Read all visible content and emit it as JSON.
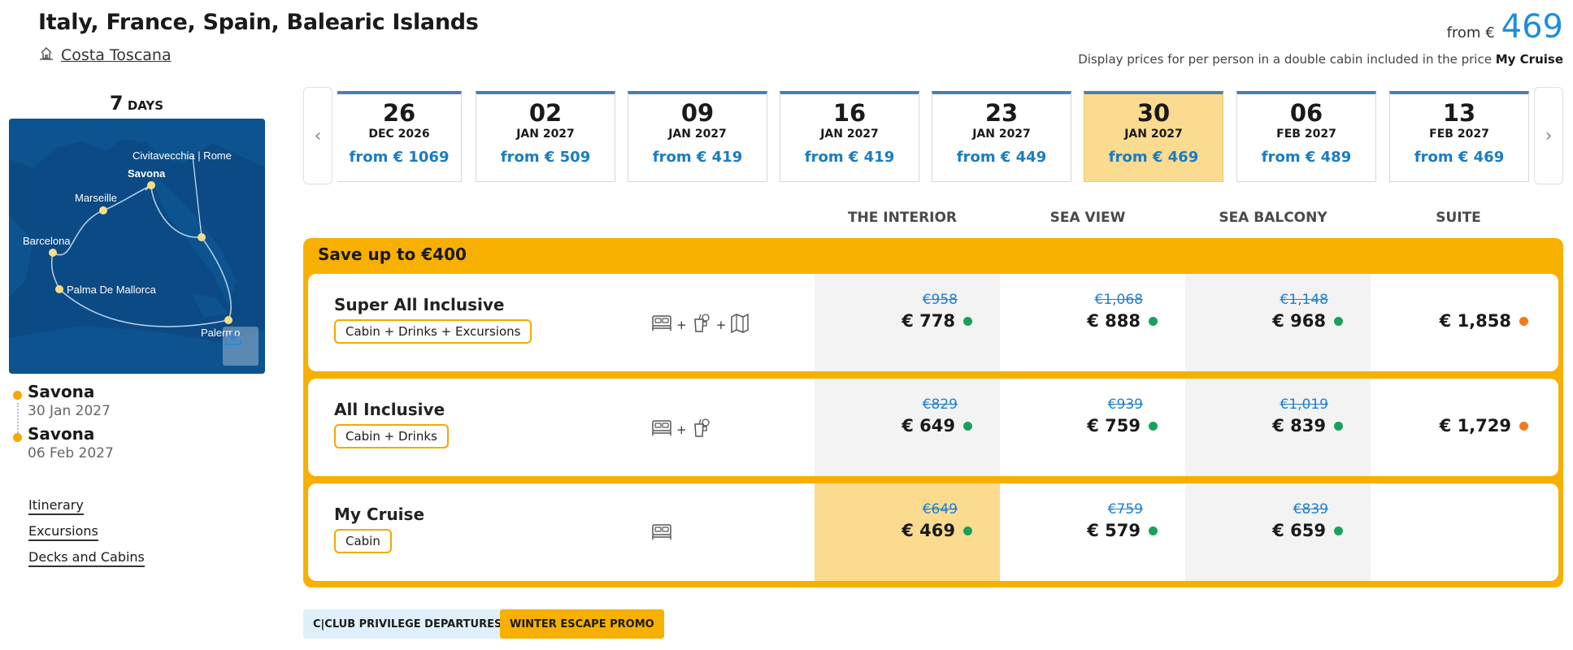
{
  "header": {
    "title": "Italy, France, Spain, Balearic Islands",
    "ship": "Costa Toscana",
    "from_label": "from €",
    "from_price": "469",
    "disclaimer": "Display prices for per person in a double cabin included in the price",
    "disclaimer_bold": "My Cruise"
  },
  "sidebar": {
    "days_num": "7",
    "days_label": "DAYS",
    "map_labels": {
      "civitavecchia": "Civitavecchia | Rome",
      "savona": "Savona",
      "marseille": "Marseille",
      "barcelona": "Barcelona",
      "palma": "Palma De Mallorca",
      "palermo": "Palermo"
    },
    "route": [
      {
        "port": "Savona",
        "date": "30 Jan 2027"
      },
      {
        "port": "Savona",
        "date": "06 Feb 2027"
      }
    ],
    "links": [
      "Itinerary",
      "Excursions",
      "Decks and Cabins"
    ]
  },
  "dates": [
    {
      "day": "26",
      "my": "DEC 2026",
      "price": "from € 1069",
      "selected": false
    },
    {
      "day": "02",
      "my": "JAN 2027",
      "price": "from € 509",
      "selected": false
    },
    {
      "day": "09",
      "my": "JAN 2027",
      "price": "from € 419",
      "selected": false
    },
    {
      "day": "16",
      "my": "JAN 2027",
      "price": "from € 419",
      "selected": false
    },
    {
      "day": "23",
      "my": "JAN 2027",
      "price": "from € 449",
      "selected": false
    },
    {
      "day": "30",
      "my": "JAN 2027",
      "price": "from € 469",
      "selected": true
    },
    {
      "day": "06",
      "my": "FEB 2027",
      "price": "from € 489",
      "selected": false
    },
    {
      "day": "13",
      "my": "FEB 2027",
      "price": "from € 469",
      "selected": false
    }
  ],
  "columns": [
    "THE INTERIOR",
    "SEA VIEW",
    "SEA BALCONY",
    "SUITE"
  ],
  "promo": {
    "title": "Save up to €400",
    "packages": [
      {
        "name": "Super All Inclusive",
        "tag": "Cabin + Drinks + Excursions",
        "icons": [
          "bed-icon",
          "drink-icon",
          "map-icon"
        ],
        "prices": [
          {
            "old": "€958",
            "new": "€ 778",
            "dot": "#1aa05b"
          },
          {
            "old": "€1,068",
            "new": "€ 888",
            "dot": "#1aa05b"
          },
          {
            "old": "€1,148",
            "new": "€ 968",
            "dot": "#1aa05b"
          },
          {
            "old": "",
            "new": "€ 1,858",
            "dot": "#f07a1a"
          }
        ]
      },
      {
        "name": "All Inclusive",
        "tag": "Cabin + Drinks",
        "icons": [
          "bed-icon",
          "drink-icon"
        ],
        "prices": [
          {
            "old": "€829",
            "new": "€ 649",
            "dot": "#1aa05b"
          },
          {
            "old": "€939",
            "new": "€ 759",
            "dot": "#1aa05b"
          },
          {
            "old": "€1,019",
            "new": "€ 839",
            "dot": "#1aa05b"
          },
          {
            "old": "",
            "new": "€ 1,729",
            "dot": "#f07a1a"
          }
        ]
      },
      {
        "name": "My Cruise",
        "tag": "Cabin",
        "icons": [
          "bed-icon"
        ],
        "prices": [
          {
            "old": "€649",
            "new": "€ 469",
            "dot": "#1aa05b"
          },
          {
            "old": "€759",
            "new": "€ 579",
            "dot": "#1aa05b"
          },
          {
            "old": "€839",
            "new": "€ 659",
            "dot": "#1aa05b"
          },
          {
            "old": "",
            "new": "",
            "dot": ""
          }
        ]
      }
    ]
  },
  "badges": {
    "club": "C|CLUB PRIVILEGE DEPARTURES",
    "winter": "WINTER ESCAPE PROMO"
  },
  "colors": {
    "accent_yellow": "#f7b000",
    "price_blue": "#1a7cc2",
    "available_green": "#1aa05b",
    "limited_orange": "#f07a1a"
  }
}
